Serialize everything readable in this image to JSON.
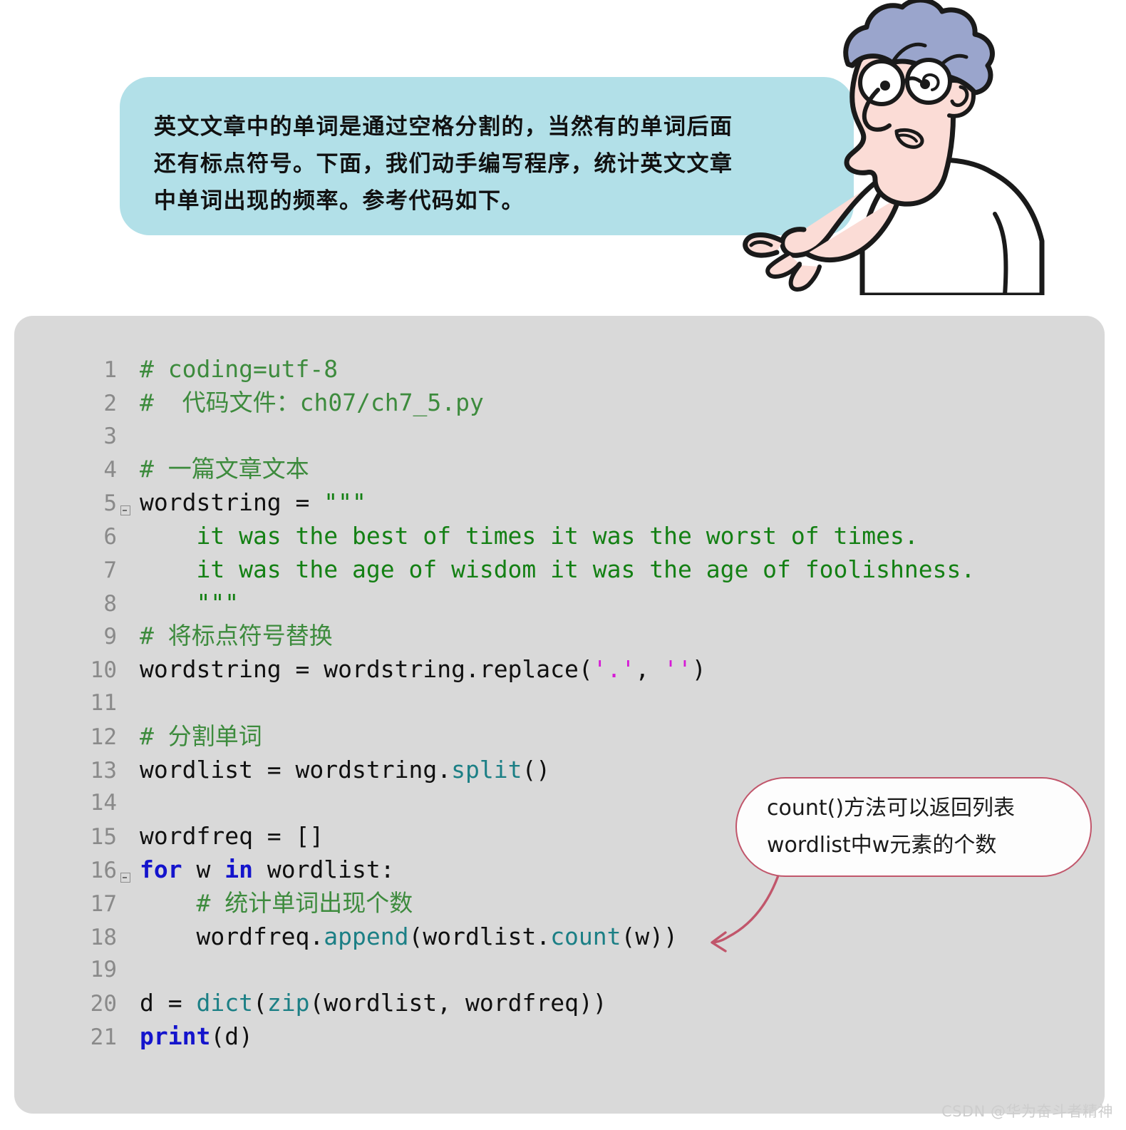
{
  "speech_bubble": {
    "background_color": "#b2e0e8",
    "lines": [
      "英文文章中的单词是通过空格分割的，当然有的单词后面",
      "还有标点符号。下面，我们动手编写程序，统计英文文章",
      "中单词出现的频率。参考代码如下。"
    ]
  },
  "character": {
    "description": "卡通老师指向气泡",
    "hair_color": "#9aa5cc",
    "skin_color": "#fbdcd6",
    "shirt_color": "#ffffff",
    "outline_color": "#1a1a1a"
  },
  "code_block": {
    "background_color": "#d9d9d9",
    "comment_color": "#3d8b3d",
    "string_color": "#148014",
    "keyword_color": "#1414cc",
    "function_color": "#1b7f85",
    "magenta_string_color": "#d61ad6",
    "line_number_color": "#8a8a8a",
    "lines": [
      {
        "number": "1",
        "fold": false,
        "tokens": [
          {
            "t": "# coding=utf-8",
            "c": "comment"
          }
        ]
      },
      {
        "number": "2",
        "fold": false,
        "tokens": [
          {
            "t": "#  代码文件：ch07/ch7_5.py",
            "c": "comment"
          }
        ]
      },
      {
        "number": "3",
        "fold": false,
        "tokens": [
          {
            "t": "",
            "c": "plain"
          }
        ]
      },
      {
        "number": "4",
        "fold": false,
        "tokens": [
          {
            "t": "# 一篇文章文本",
            "c": "comment"
          }
        ]
      },
      {
        "number": "5",
        "fold": true,
        "tokens": [
          {
            "t": "wordstring = ",
            "c": "plain"
          },
          {
            "t": "\"\"\"",
            "c": "string"
          }
        ]
      },
      {
        "number": "6",
        "fold": false,
        "tokens": [
          {
            "t": "    it was the best of times it was the worst of times.",
            "c": "string"
          }
        ]
      },
      {
        "number": "7",
        "fold": false,
        "tokens": [
          {
            "t": "    it was the age of wisdom it was the age of foolishness.",
            "c": "string"
          }
        ]
      },
      {
        "number": "8",
        "fold": false,
        "tokens": [
          {
            "t": "    \"\"\"",
            "c": "string"
          }
        ]
      },
      {
        "number": "9",
        "fold": false,
        "tokens": [
          {
            "t": "# 将标点符号替换",
            "c": "comment"
          }
        ]
      },
      {
        "number": "10",
        "fold": false,
        "tokens": [
          {
            "t": "wordstring = wordstring.replace(",
            "c": "plain"
          },
          {
            "t": "'.'",
            "c": "magenta"
          },
          {
            "t": ", ",
            "c": "plain"
          },
          {
            "t": "''",
            "c": "magenta"
          },
          {
            "t": ")",
            "c": "plain"
          }
        ]
      },
      {
        "number": "11",
        "fold": false,
        "tokens": [
          {
            "t": "",
            "c": "plain"
          }
        ]
      },
      {
        "number": "12",
        "fold": false,
        "tokens": [
          {
            "t": "# 分割单词",
            "c": "comment"
          }
        ]
      },
      {
        "number": "13",
        "fold": false,
        "tokens": [
          {
            "t": "wordlist = wordstring.",
            "c": "plain"
          },
          {
            "t": "split",
            "c": "fn"
          },
          {
            "t": "()",
            "c": "plain"
          }
        ]
      },
      {
        "number": "14",
        "fold": false,
        "tokens": [
          {
            "t": "",
            "c": "plain"
          }
        ]
      },
      {
        "number": "15",
        "fold": false,
        "tokens": [
          {
            "t": "wordfreq = []",
            "c": "plain"
          }
        ]
      },
      {
        "number": "16",
        "fold": true,
        "tokens": [
          {
            "t": "for",
            "c": "kw"
          },
          {
            "t": " w ",
            "c": "plain"
          },
          {
            "t": "in",
            "c": "kw"
          },
          {
            "t": " wordlist:",
            "c": "plain"
          }
        ]
      },
      {
        "number": "17",
        "fold": false,
        "tokens": [
          {
            "t": "    # 统计单词出现个数",
            "c": "comment"
          }
        ]
      },
      {
        "number": "18",
        "fold": false,
        "tokens": [
          {
            "t": "    wordfreq.",
            "c": "plain"
          },
          {
            "t": "append",
            "c": "fn"
          },
          {
            "t": "(wordlist.",
            "c": "plain"
          },
          {
            "t": "count",
            "c": "fn"
          },
          {
            "t": "(w))",
            "c": "plain"
          }
        ]
      },
      {
        "number": "19",
        "fold": false,
        "tokens": [
          {
            "t": "",
            "c": "plain"
          }
        ]
      },
      {
        "number": "20",
        "fold": false,
        "tokens": [
          {
            "t": "d = ",
            "c": "plain"
          },
          {
            "t": "dict",
            "c": "fn"
          },
          {
            "t": "(",
            "c": "plain"
          },
          {
            "t": "zip",
            "c": "fn"
          },
          {
            "t": "(wordlist, wordfreq))",
            "c": "plain"
          }
        ]
      },
      {
        "number": "21",
        "fold": false,
        "tokens": [
          {
            "t": "print",
            "c": "kw"
          },
          {
            "t": "(d)",
            "c": "plain"
          }
        ]
      }
    ]
  },
  "callout": {
    "border_color": "#c1566b",
    "background_color": "#fdfdfd",
    "lines": [
      "count()方法可以返回列表",
      "wordlist中w元素的个数"
    ],
    "arrow_color": "#c1566b",
    "arrow_target": "line 18 wordfreq.append(wordlist.count(w))"
  },
  "watermark": {
    "text": "CSDN @华为奋斗者精神",
    "color": "#cdcdcd"
  }
}
